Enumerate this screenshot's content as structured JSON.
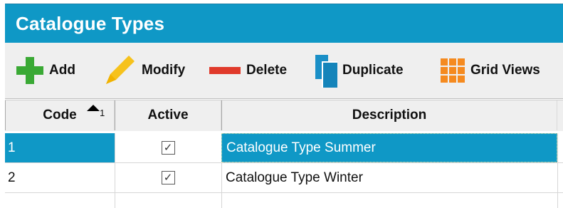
{
  "window": {
    "title": "Catalogue Types"
  },
  "toolbar": {
    "add_label": "Add",
    "modify_label": "Modify",
    "delete_label": "Delete",
    "duplicate_label": "Duplicate",
    "gridviews_label": "Grid Views",
    "icons": [
      "plus-icon",
      "pencil-icon",
      "minus-icon",
      "duplicate-icon",
      "grid-icon"
    ]
  },
  "table": {
    "columns": [
      {
        "label": "Code",
        "sort": "ascending",
        "sort_order": "1"
      },
      {
        "label": "Active"
      },
      {
        "label": "Description"
      }
    ],
    "rows": [
      {
        "code": "1",
        "active": true,
        "description": "Catalogue Type Summer",
        "selected": true
      },
      {
        "code": "2",
        "active": true,
        "description": "Catalogue Type Winter",
        "selected": false
      }
    ]
  },
  "colors": {
    "accent": "#0f98c6",
    "add_icon": "#3aa935",
    "delete_icon": "#e03a2b",
    "modify_icon": "#f6c21c",
    "duplicate_icon": "#1a8fc7",
    "gridviews_icon": "#f58a1f"
  }
}
